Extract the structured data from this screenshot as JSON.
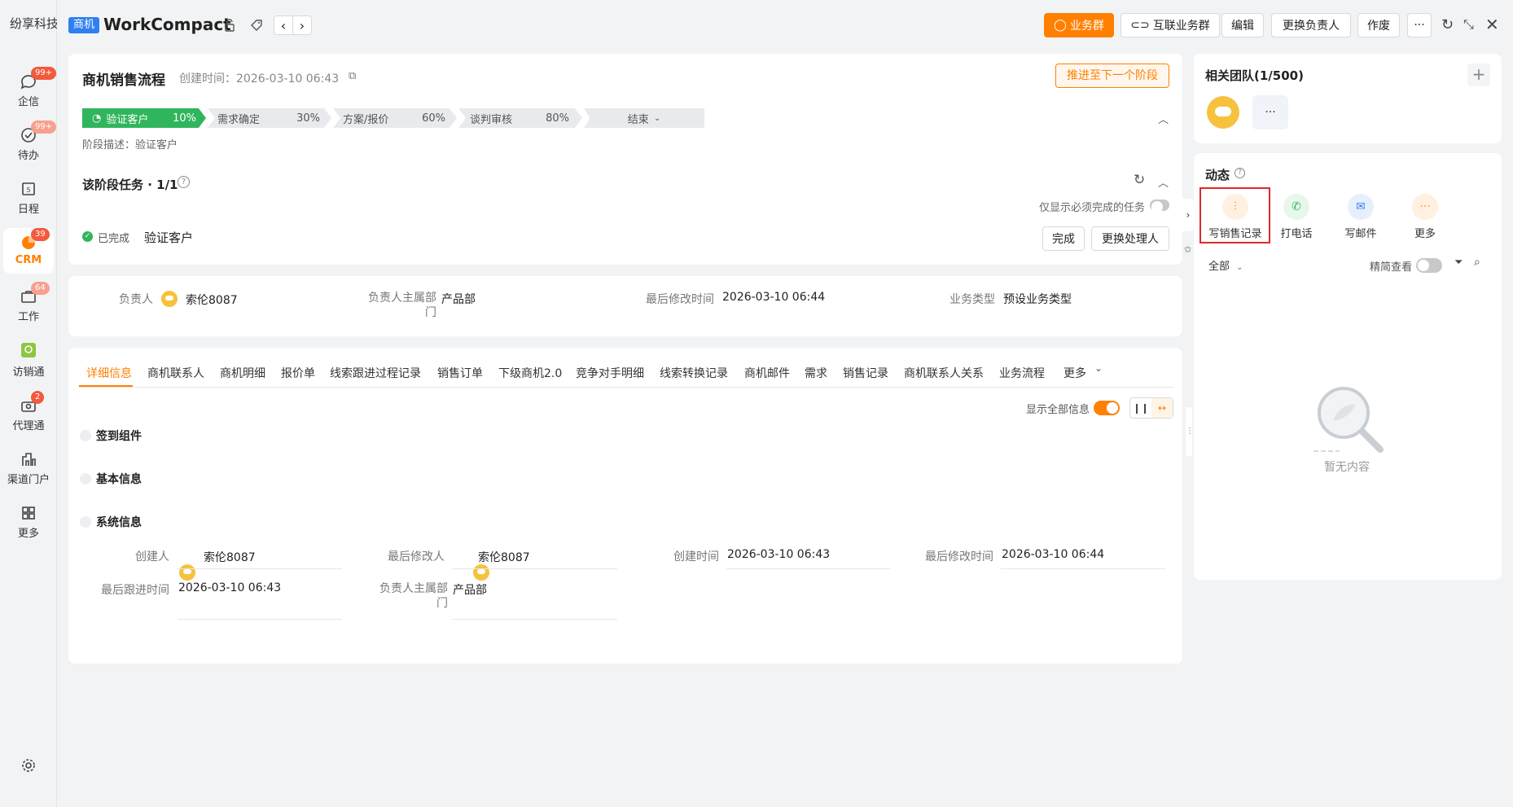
{
  "company": "纷享科技",
  "nav": [
    {
      "label": "企信",
      "badge": "99+"
    },
    {
      "label": "待办",
      "badge": "99+"
    },
    {
      "label": "日程",
      "badge": ""
    },
    {
      "label": "CRM",
      "badge": "39"
    },
    {
      "label": "工作",
      "badge": "64"
    },
    {
      "label": "访销通",
      "badge": ""
    },
    {
      "label": "代理通",
      "badge": "2"
    },
    {
      "label": "渠道门户",
      "badge": ""
    },
    {
      "label": "更多",
      "badge": ""
    }
  ],
  "header": {
    "object_tag": "商机",
    "title": "WorkCompact",
    "btn_group": "业务群",
    "btn_interlink": "互联业务群",
    "btn_edit": "编辑",
    "btn_change_owner": "更换负责人",
    "btn_void": "作废",
    "btn_more": "···"
  },
  "flow": {
    "title": "商机销售流程",
    "created": "创建时间：2026-03-10 06:43",
    "advance_btn": "推进至下一个阶段",
    "stages": [
      {
        "name": "验证客户",
        "pct": "10%"
      },
      {
        "name": "需求确定",
        "pct": "30%"
      },
      {
        "name": "方案/报价",
        "pct": "60%"
      },
      {
        "name": "谈判审核",
        "pct": "80%"
      },
      {
        "name": "结束",
        "pct": ""
      }
    ],
    "stage_desc": "阶段描述：验证客户",
    "task_title": "该阶段任务 · 1/1",
    "only_required": "仅显示必须完成的任务",
    "task_status": "已完成",
    "task_name": "验证客户",
    "btn_done": "完成",
    "btn_change_handler": "更换处理人"
  },
  "summary": {
    "owner_label": "负责人",
    "owner": "索伦8087",
    "dept_label": "负责人主属部门",
    "dept": "产品部",
    "modified_label": "最后修改时间",
    "modified": "2026-03-10 06:44",
    "biz_label": "业务类型",
    "biz": "预设业务类型"
  },
  "tabs": [
    "详细信息",
    "商机联系人",
    "商机明细",
    "报价单",
    "线索跟进过程记录",
    "销售订单",
    "下级商机2.0",
    "竞争对手明细",
    "线索转换记录",
    "商机邮件",
    "需求",
    "销售记录",
    "商机联系人关系",
    "业务流程",
    "更多"
  ],
  "detail": {
    "show_all": "显示全部信息",
    "sections": [
      "签到组件",
      "基本信息",
      "系统信息"
    ],
    "fields": {
      "creator_label": "创建人",
      "creator": "索伦8087",
      "last_mod_by_label": "最后修改人",
      "last_mod_by": "索伦8087",
      "created_label": "创建时间",
      "created": "2026-03-10 06:43",
      "last_mod_label": "最后修改时间",
      "last_mod": "2026-03-10 06:44",
      "last_follow_label": "最后跟进时间",
      "last_follow": "2026-03-10 06:43",
      "dept_label": "负责人主属部门",
      "dept": "产品部"
    }
  },
  "team": {
    "title": "相关团队(1/500)",
    "more": "···"
  },
  "activity": {
    "title": "动态",
    "actions": [
      "写销售记录",
      "打电话",
      "写邮件",
      "更多"
    ],
    "filter": "全部",
    "simple_view": "精简查看",
    "empty": "暂无内容"
  },
  "colors": {
    "accent": "#ff8000",
    "blue": "#2f7ff0",
    "green": "#30b55c"
  }
}
